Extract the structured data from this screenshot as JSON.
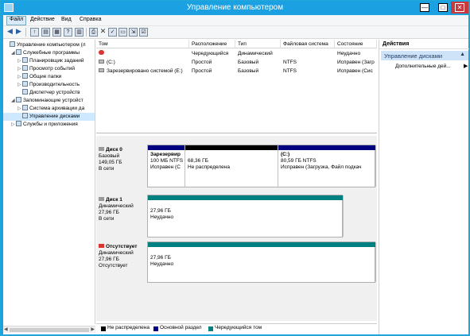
{
  "window": {
    "title": "Управление компьютером"
  },
  "menu": [
    "Файл",
    "Действие",
    "Вид",
    "Справка"
  ],
  "tree": [
    {
      "label": "Управление компьютером (л",
      "indent": 0,
      "arrow": "",
      "icon": "computer-icon",
      "selected": false
    },
    {
      "label": "Служебные программы",
      "indent": 1,
      "arrow": "◢",
      "icon": "tools-icon",
      "selected": false
    },
    {
      "label": "Планировщик заданий",
      "indent": 2,
      "arrow": "▷",
      "icon": "clock-icon",
      "selected": false
    },
    {
      "label": "Просмотр событий",
      "indent": 2,
      "arrow": "▷",
      "icon": "event-viewer-icon",
      "selected": false
    },
    {
      "label": "Общие папки",
      "indent": 2,
      "arrow": "▷",
      "icon": "shared-folder-icon",
      "selected": false
    },
    {
      "label": "Производительность",
      "indent": 2,
      "arrow": "▷",
      "icon": "performance-icon",
      "selected": false
    },
    {
      "label": "Диспетчер устройств",
      "indent": 2,
      "arrow": "",
      "icon": "device-manager-icon",
      "selected": false
    },
    {
      "label": "Запоминающие устройст",
      "indent": 1,
      "arrow": "◢",
      "icon": "storage-icon",
      "selected": false
    },
    {
      "label": "Система архивации да",
      "indent": 2,
      "arrow": "▷",
      "icon": "backup-icon",
      "selected": false
    },
    {
      "label": "Управление дисками",
      "indent": 2,
      "arrow": "",
      "icon": "disk-management-icon",
      "selected": true
    },
    {
      "label": "Службы и приложения",
      "indent": 1,
      "arrow": "▷",
      "icon": "services-icon",
      "selected": false
    }
  ],
  "volume_table": {
    "headers": [
      "Том",
      "Расположение",
      "Тип",
      "Файловая система",
      "Состояние"
    ],
    "rows": [
      {
        "name": "",
        "icon": "missing-disk-icon",
        "layout": "Чередующийся",
        "type": "Динамический",
        "fs": "",
        "status": "Неудачно"
      },
      {
        "name": "(C:)",
        "icon": "disk-icon",
        "layout": "Простой",
        "type": "Базовый",
        "fs": "NTFS",
        "status": "Исправен (Загр"
      },
      {
        "name": "Зарезервировано системой (E:)",
        "icon": "disk-icon",
        "layout": "Простой",
        "type": "Базовый",
        "fs": "NTFS",
        "status": "Исправен (Сис"
      }
    ]
  },
  "disks": [
    {
      "name": "Диск 0",
      "kind": "Базовый",
      "size": "149,05 ГБ",
      "state": "В сети",
      "partitions": [
        {
          "title": "Зарезервир",
          "line1": "100 МБ NTFS",
          "line2": "Исправен (С",
          "color": "#000080"
        },
        {
          "title": "",
          "line1": "68,36 ГБ",
          "line2": "Не распределена",
          "color": "#000000"
        },
        {
          "title": "(C:)",
          "line1": "80,59 ГБ NTFS",
          "line2": "Исправен (Загрузка, Файл подкач",
          "color": "#000080"
        }
      ]
    },
    {
      "name": "Диск 1",
      "kind": "Динамический",
      "size": "27,96 ГБ",
      "state": "В сети",
      "partitions": [
        {
          "title": "",
          "line1": "27,96 ГБ",
          "line2": "Неудачно",
          "color": "#008080"
        }
      ]
    },
    {
      "name": "Отсутствует",
      "kind": "Динамический",
      "size": "27,96 ГБ",
      "state": "Отсутствует",
      "partitions": [
        {
          "title": "",
          "line1": "27,96 ГБ",
          "line2": "Неудачно",
          "color": "#008080"
        }
      ]
    }
  ],
  "legend": [
    {
      "label": "Не распределена",
      "color": "#000000"
    },
    {
      "label": "Основной раздел",
      "color": "#000080"
    },
    {
      "label": "Чередующийся том",
      "color": "#008080"
    }
  ],
  "actions": {
    "header": "Действия",
    "section": "Управление дисками",
    "item": "Дополнительные дей..."
  }
}
